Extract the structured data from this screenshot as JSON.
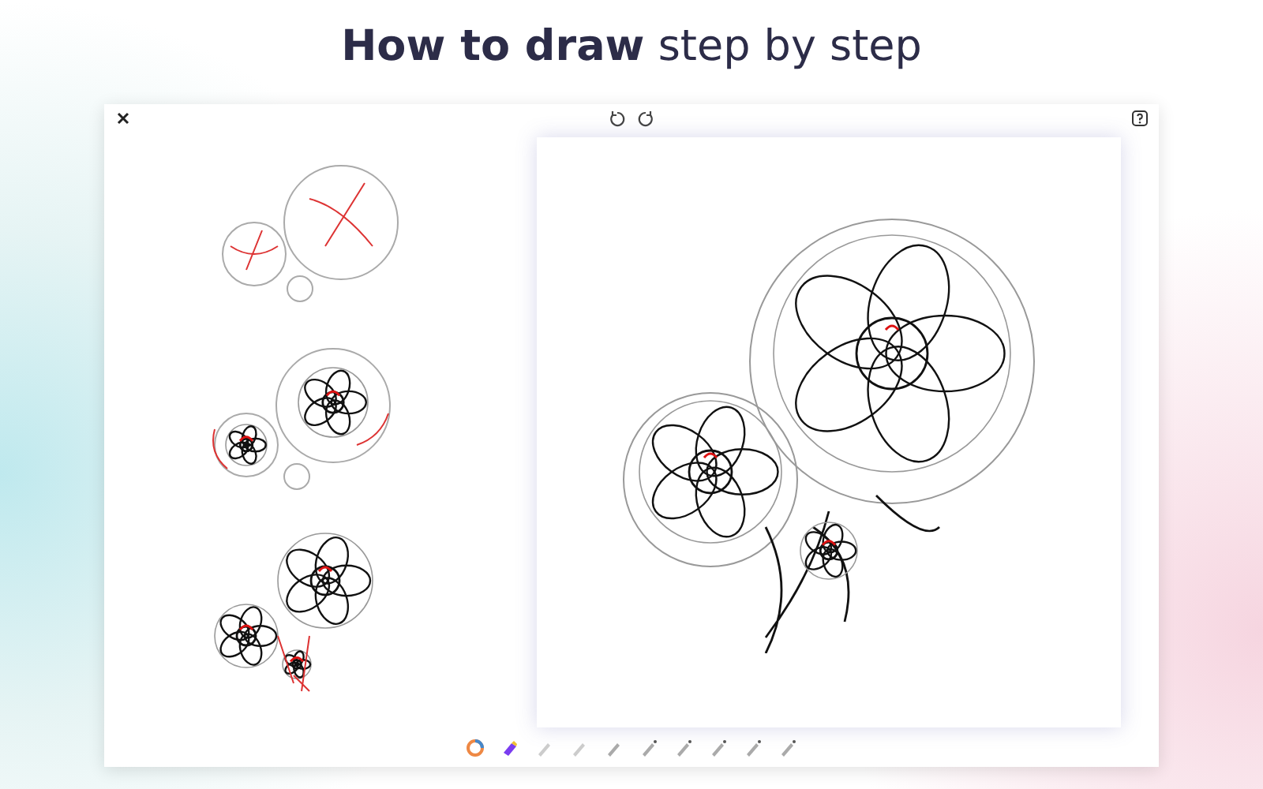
{
  "headline": "**How to draw** step by step"
}
